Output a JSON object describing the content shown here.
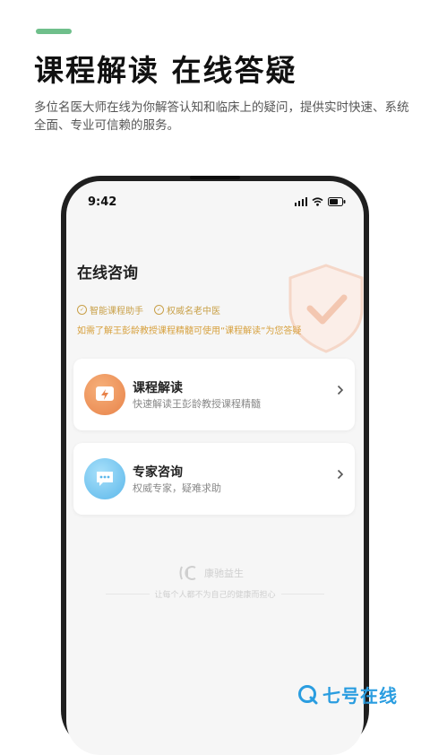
{
  "headline": "课程解读 在线答疑",
  "subtitle": "多位名医大师在线为你解答认知和临床上的疑问，提供实时快速、系统全面、专业可信赖的服务。",
  "phone": {
    "status_time": "9:42",
    "page_title": "在线咨询",
    "features": [
      "智能课程助手",
      "权威名老中医"
    ],
    "feature_desc": "如需了解王彭龄教授课程精髓可使用“课程解读”为您答疑",
    "cards": [
      {
        "title": "课程解读",
        "desc": "快速解读王彭龄教授课程精髓",
        "icon": "lightning-chat-icon"
      },
      {
        "title": "专家咨询",
        "desc": "权威专家，疑难求助",
        "icon": "chat-bubble-icon"
      }
    ],
    "brand_name": "康驰益生",
    "brand_slogan": "让每个人都不为自己的健康而担心"
  },
  "watermark": "七号在线",
  "colors": {
    "accent_green": "#6fbf8b",
    "gold": "#d7a13f",
    "orange_icon": "#e8834a",
    "blue_icon": "#5bb7ea",
    "watermark_blue": "#2a9de0"
  }
}
